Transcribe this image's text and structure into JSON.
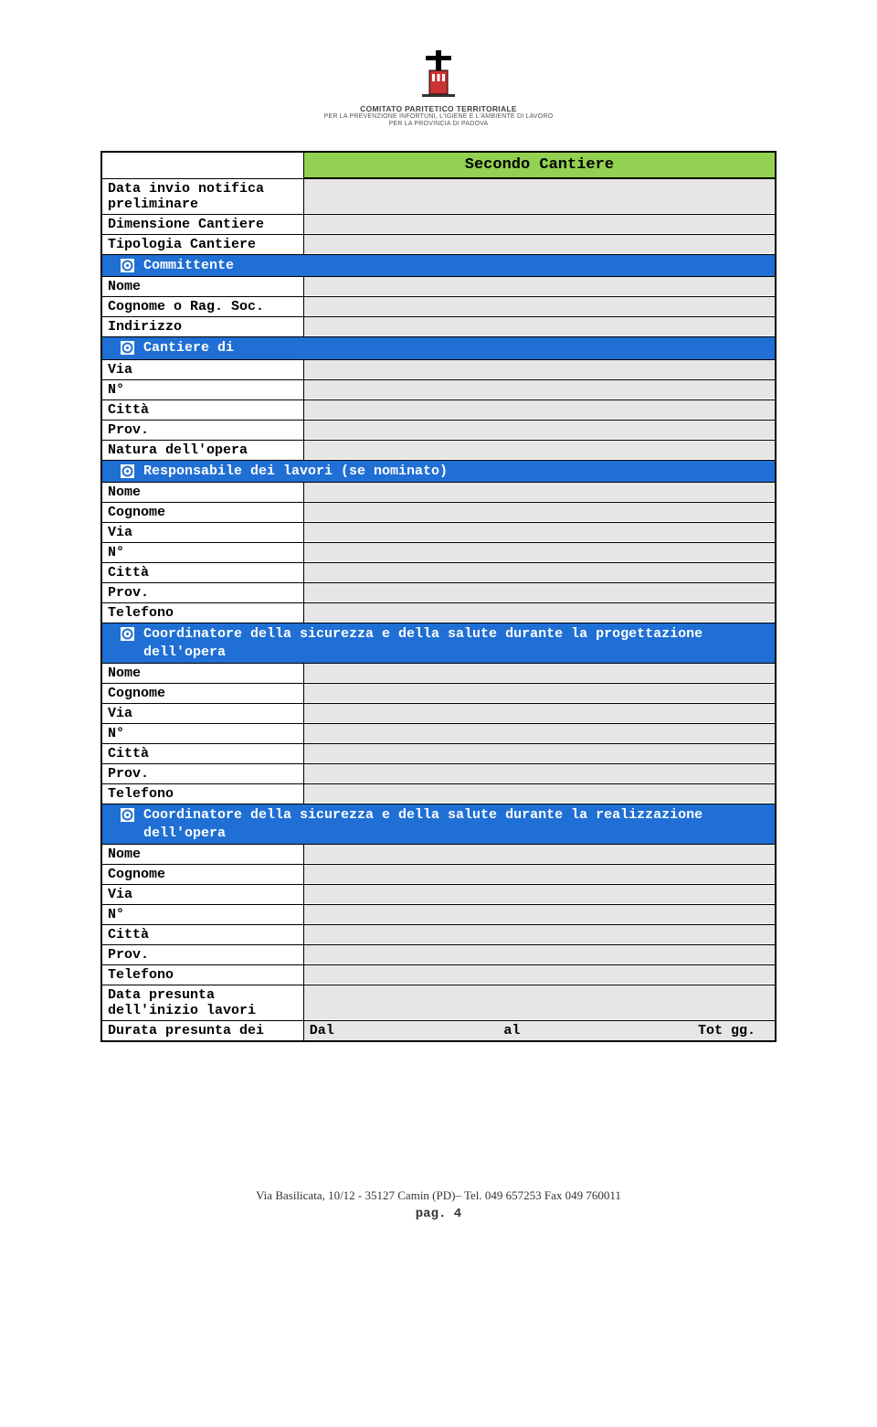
{
  "header": {
    "org_line1": "COMITATO PARITETICO TERRITORIALE",
    "org_line2": "PER LA PREVENZIONE INFORTUNI, L'IGIENE E L'AMBIENTE DI LAVORO",
    "org_line3": "PER LA PROVINCIA DI PADOVA"
  },
  "title": "Secondo Cantiere",
  "fields": {
    "data_invio": "Data invio notifica preliminare",
    "dimensione": "Dimensione Cantiere",
    "tipologia": "Tipologia Cantiere"
  },
  "sections": {
    "committente": {
      "title": "Committente",
      "nome": "Nome",
      "cognome": "Cognome o Rag. Soc.",
      "indirizzo": "Indirizzo"
    },
    "cantiere_di": {
      "title": "Cantiere di",
      "via": "Via",
      "n": "N°",
      "citta": "Città",
      "prov": "Prov.",
      "natura": "Natura dell'opera"
    },
    "responsabile": {
      "title": "Responsabile dei lavori (se nominato)",
      "nome": "Nome",
      "cognome": "Cognome",
      "via": "Via",
      "n": "N°",
      "citta": "Città",
      "prov": "Prov.",
      "telefono": "Telefono"
    },
    "coord_prog": {
      "title": "Coordinatore della sicurezza e della salute durante la progettazione dell'opera",
      "nome": "Nome",
      "cognome": "Cognome",
      "via": "Via",
      "n": "N°",
      "citta": "Città",
      "prov": "Prov.",
      "telefono": "Telefono"
    },
    "coord_real": {
      "title": "Coordinatore della sicurezza e della salute durante la realizzazione dell'opera",
      "nome": "Nome",
      "cognome": "Cognome",
      "via": "Via",
      "n": "N°",
      "citta": "Città",
      "prov": "Prov.",
      "telefono": "Telefono"
    },
    "data_presunta": "Data presunta dell'inizio lavori",
    "durata": {
      "label": "Durata presunta dei",
      "dal": "Dal",
      "al": "al",
      "tot": "Tot gg."
    }
  },
  "footer": {
    "address": "Via Basilicata, 10/12 - 35127 Camin (PD)– Tel. 049 657253 Fax 049 760011",
    "page": "pag. 4"
  }
}
